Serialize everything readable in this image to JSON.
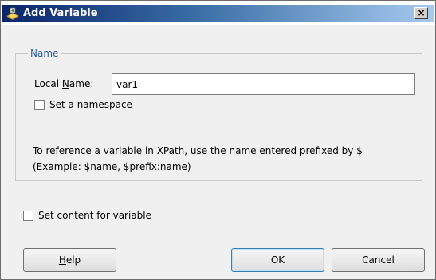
{
  "window": {
    "title": "Add Variable",
    "close_glyph": "×",
    "icon": "add-variable-icon"
  },
  "name_group": {
    "legend": "Name",
    "local_name_label_pre": "Local ",
    "local_name_label_mnemonic": "N",
    "local_name_label_post": "ame:",
    "local_name_value": "var1",
    "namespace_checkbox_label": "Set a namespace",
    "namespace_checked": false,
    "info_line1": "To reference a variable in XPath, use the name entered prefixed by $",
    "info_line2": "(Example: $name, $prefix:name)"
  },
  "content_checkbox": {
    "label": "Set content for variable",
    "checked": false
  },
  "buttons": {
    "help_mnemonic": "H",
    "help_rest": "elp",
    "ok": "OK",
    "cancel": "Cancel"
  },
  "colors": {
    "legend": "#2f5fa8",
    "title_bar_start": "#0a246a",
    "title_bar_end": "#a6caf0"
  }
}
